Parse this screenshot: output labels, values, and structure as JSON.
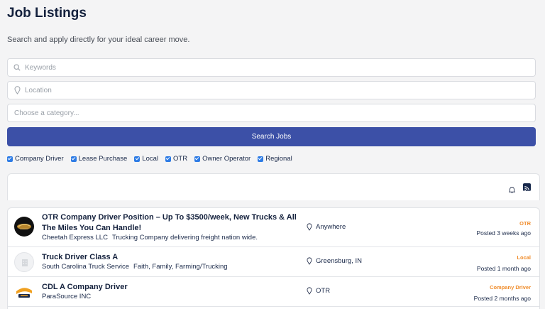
{
  "page": {
    "title": "Job Listings",
    "subtitle": "Search and apply directly for your ideal career move."
  },
  "search": {
    "keywords_placeholder": "Keywords",
    "location_placeholder": "Location",
    "category_placeholder": "Choose a category...",
    "button_label": "Search Jobs"
  },
  "filters": [
    {
      "label": "Company Driver",
      "checked": true
    },
    {
      "label": "Lease Purchase",
      "checked": true
    },
    {
      "label": "Local",
      "checked": true
    },
    {
      "label": "OTR",
      "checked": true
    },
    {
      "label": "Owner Operator",
      "checked": true
    },
    {
      "label": "Regional",
      "checked": true
    }
  ],
  "toolbar": {
    "icons": [
      "bell-icon",
      "rss-icon"
    ]
  },
  "jobs": [
    {
      "title": "OTR Company Driver Position – Up To $3500/week, New Trucks & All The Miles You Can Handle!",
      "company": "Cheetah Express LLC",
      "description": "Trucking Company delivering freight nation wide.",
      "location": "Anywhere",
      "type": "OTR",
      "posted": "Posted 3 weeks ago",
      "logo": "cheetah-express-logo"
    },
    {
      "title": "Truck Driver Class A",
      "company": "South Carolina Truck Service",
      "description": "Faith, Family, Farming/Trucking",
      "location": "Greensburg, IN",
      "type": "Local",
      "posted": "Posted 1 month ago",
      "logo": "company-placeholder-icon"
    },
    {
      "title": "CDL A Company Driver",
      "company": "ParaSource INC",
      "description": "",
      "location": "OTR",
      "type": "Company Driver",
      "posted": "Posted 2 months ago",
      "logo": "parasource-logo"
    }
  ],
  "colors": {
    "primary": "#3c50a7",
    "accent": "#f08c2a",
    "checkbox": "#2d7be5",
    "heading": "#14213d"
  }
}
